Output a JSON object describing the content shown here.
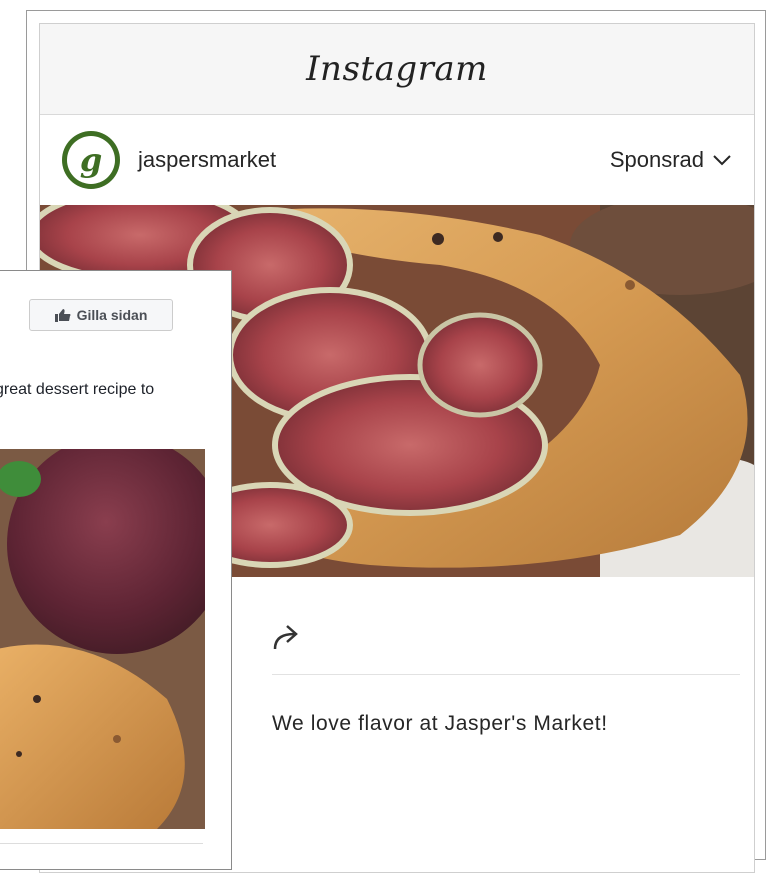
{
  "instagram": {
    "logo": "Instagram",
    "account": {
      "avatar_letter": "g",
      "username": "jaspersmarket",
      "sponsored_label": "Sponsrad"
    },
    "caption": "We love flavor at Jasper's Market!",
    "colors": {
      "avatar_green": "#3e6e23",
      "header_bg": "#f6f6f6"
    }
  },
  "facebook": {
    "like_button_label": "Gilla sidan",
    "post_text": "great dessert recipe to",
    "colors": {
      "button_bg": "#f6f7f9",
      "button_text": "#4b4f56"
    }
  },
  "icons": [
    "chevron-down-icon",
    "share-arrow-icon",
    "thumbs-up-icon"
  ]
}
